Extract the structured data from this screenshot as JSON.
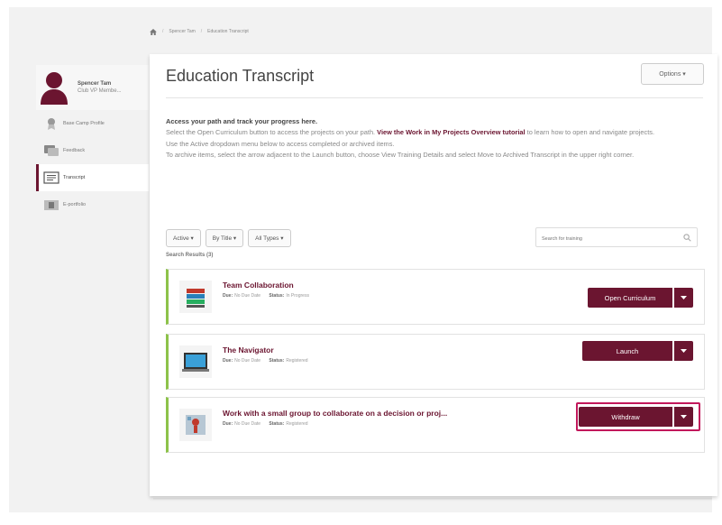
{
  "breadcrumb": [
    "Spencer Tam",
    "Education Transcript"
  ],
  "profile": {
    "name": "Spencer Tam",
    "subtitle": "Club VP Membe..."
  },
  "sidebar": {
    "items": [
      {
        "label": "Base Camp Profile",
        "icon": "badge-icon"
      },
      {
        "label": "Feedback",
        "icon": "feedback-icon"
      },
      {
        "label": "Transcript",
        "icon": "transcript-icon",
        "active": true
      },
      {
        "label": "E-portfolio",
        "icon": "portfolio-icon"
      }
    ]
  },
  "header": {
    "title": "Education Transcript",
    "options_label": "Options ▾"
  },
  "intro": {
    "heading": "Access your path and track your progress here.",
    "line1_a": "Select the Open Curriculum button to access the projects on your path. ",
    "line1_link": "View the Work in My Projects Overview tutorial",
    "line1_b": " to learn how to open and navigate projects.",
    "line2": "Use the Active dropdown menu below to access completed or archived items.",
    "line3": "To archive items, select the arrow adjacent to the Launch button, choose View Training Details and select Move to Archived Transcript in the upper right corner."
  },
  "filters": [
    "Active ▾",
    "By Title ▾",
    "All Types ▾"
  ],
  "search": {
    "placeholder": "Search for training"
  },
  "results_label": "Search Results (3)",
  "meta_labels": {
    "due": "Due:",
    "status": "Status:"
  },
  "rows": [
    {
      "title": "Team Collaboration",
      "due": "No Due Date",
      "status": "In Progress",
      "action": "Open Curriculum"
    },
    {
      "title": "The Navigator",
      "due": "No Due Date",
      "status": "Registered",
      "action": "Launch"
    },
    {
      "title": "Work with a small group to collaborate on a decision or proj...",
      "due": "No Due Date",
      "status": "Registered",
      "action": "Withdraw"
    }
  ],
  "colors": {
    "accent": "#6b1530",
    "active_bar": "#8dc24a",
    "highlight": "#c2185b"
  }
}
